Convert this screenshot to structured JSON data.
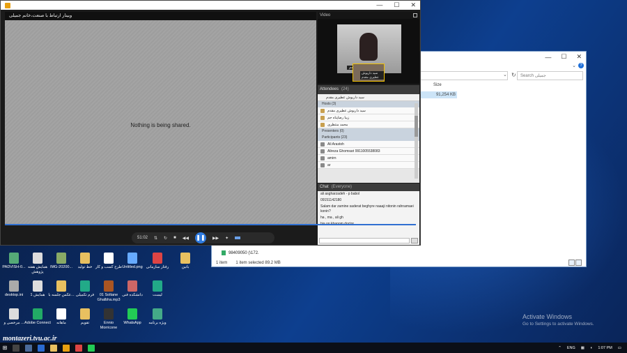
{
  "webinar": {
    "share_header": "وبینار ارتباط با صنعت،خانم جمیلی",
    "nothing_shared": "Nothing is being shared.",
    "player": {
      "time": "51:02"
    },
    "video_pod": {
      "title": "Video",
      "main_name": "زیبا رضاپناه جم",
      "thumb_name": "سید داریوش عطیری مقدم"
    },
    "attendees": {
      "title": "Attendees",
      "count": "(24)",
      "me": "سید داریوش عطیری مقدم",
      "hosts_label": "Hosts (3)",
      "hosts": [
        "سید داریوش عطیری مقدم",
        "زیبا رضاپناه جم",
        "محمد منتظری"
      ],
      "presenters_label": "Presenters (0)",
      "participants_label": "Participants (23)",
      "participants": [
        "Ali Arastoh",
        "Alireza Ghomsari 9911005538083",
        "amirn",
        "ar"
      ]
    },
    "chat": {
      "title": "Chat",
      "scope": "(Everyone)",
      "lines": [
        "ali asgharzadeh - p babol",
        "09151142180",
        "Salam dar zamine saderat beghyre naaaji nitonin rahnamaei konin?",
        "ha , ma , ali gh",
        "bia on khanom doctor"
      ]
    }
  },
  "explorer": {
    "search_placeholder": "Search جمیلی",
    "size_header": "Size",
    "selected_size": "91,254 KB",
    "file_row": "98409050 (\\172.",
    "status_items": "1 item",
    "status_selected": "1 item selected  89.2 MB"
  },
  "desktop_icons": [
    {
      "label": "PADVISH-0...",
      "color": "#5a7"
    },
    {
      "label": "همایش هفته پژوهش",
      "color": "#ddd"
    },
    {
      "label": "IMG-20200...",
      "color": "#8a6"
    },
    {
      "label": "خط تولید",
      "color": "#e8c060"
    },
    {
      "label": "طرح کسب و کار",
      "color": "#fff"
    },
    {
      "label": "Untitled.png",
      "color": "#6af"
    },
    {
      "label": "رفتار سازمانی",
      "color": "#d44"
    },
    {
      "label": "بانین",
      "color": "#e8c060"
    },
    {
      "label": "desktop.ini",
      "color": "#aaa"
    },
    {
      "label": "همایش 1",
      "color": "#ddd"
    },
    {
      "label": "عکس جلسه با...",
      "color": "#e8c060"
    },
    {
      "label": "فرم تکمیلی",
      "color": "#2a8"
    },
    {
      "label": "01 Soltane Ghalbha.mp3",
      "color": "#a52"
    },
    {
      "label": "دانشکده فنی",
      "color": "#c66"
    },
    {
      "label": "لیست",
      "color": "#2a8"
    },
    {
      "label": "مرخصی و ...",
      "color": "#ddd"
    },
    {
      "label": "Adobe Connect",
      "color": "#2a6"
    },
    {
      "label": "ماهانه",
      "color": "#fff"
    },
    {
      "label": "تقویم",
      "color": "#e8c060"
    },
    {
      "label": "Ennio Morricone",
      "color": "#333"
    },
    {
      "label": "WhatsApp",
      "color": "#2c5"
    },
    {
      "label": "ویژه برنامه",
      "color": "#4a8"
    }
  ],
  "watermark": {
    "line1": "Activate Windows",
    "line2": "Go to Settings to activate Windows."
  },
  "overlay": {
    "site": "montazeri.tvu.ac.ir"
  },
  "taskbar": {
    "lang": "ENG",
    "time": "1:07 PM"
  }
}
